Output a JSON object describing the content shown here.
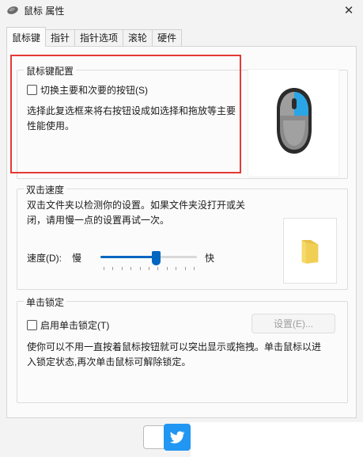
{
  "window": {
    "title": "鼠标 属性",
    "close_icon": "close-icon"
  },
  "tabs": [
    {
      "label": "鼠标键",
      "active": true
    },
    {
      "label": "指针"
    },
    {
      "label": "指针选项"
    },
    {
      "label": "滚轮"
    },
    {
      "label": "硬件"
    }
  ],
  "button_config": {
    "title": "鼠标键配置",
    "checkbox_label": "切换主要和次要的按钮(S)",
    "checked": false,
    "description_line1": "选择此复选框来将右按钮设成如选择和拖放等主要",
    "description_line2": "性能使用。"
  },
  "double_click": {
    "title": "双击速度",
    "description_line1": "双击文件夹以检测你的设置。如果文件夹没打开或关",
    "description_line2": "闭，请用慢一点的设置再试一次。",
    "speed_label": "速度(D):",
    "slow_label": "慢",
    "fast_label": "快",
    "speed_level_percent": 58
  },
  "click_lock": {
    "title": "单击锁定",
    "checkbox_label": "启用单击锁定(T)",
    "checked": false,
    "settings_button": "设置(E)...",
    "description_line1": "使你可以不用一直按着鼠标按钮就可以突出显示或拖拽。单击鼠标以进",
    "description_line2": "入锁定状态,再次单击鼠标可解除锁定。"
  },
  "colors": {
    "accent": "#0067c0",
    "highlight": "#e53935",
    "twitter": "#2196f3"
  }
}
